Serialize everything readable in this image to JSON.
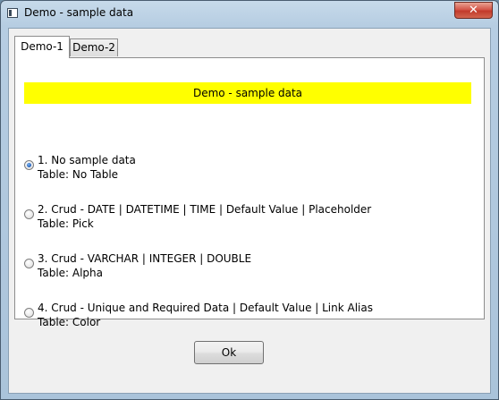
{
  "window": {
    "title": "Demo - sample data",
    "close_label": "✕"
  },
  "tabs": [
    {
      "label": "Demo-1",
      "active": true
    },
    {
      "label": "Demo-2",
      "active": false
    }
  ],
  "panel": {
    "banner": "Demo - sample data",
    "options": [
      {
        "line1": "1. No sample data",
        "line2": "Table: No Table",
        "checked": true
      },
      {
        "line1": "2. Crud - DATE | DATETIME | TIME |  Default Value | Placeholder",
        "line2": "Table: Pick",
        "checked": false
      },
      {
        "line1": "3. Crud - VARCHAR | INTEGER | DOUBLE",
        "line2": "Table: Alpha",
        "checked": false
      },
      {
        "line1": "4. Crud - Unique and Required Data | Default Value | Link Alias",
        "line2": "Table: Color",
        "checked": false
      }
    ]
  },
  "footer": {
    "ok_label": "Ok"
  },
  "colors": {
    "banner_bg": "#ffff00",
    "close_button": "#c23a2b"
  }
}
